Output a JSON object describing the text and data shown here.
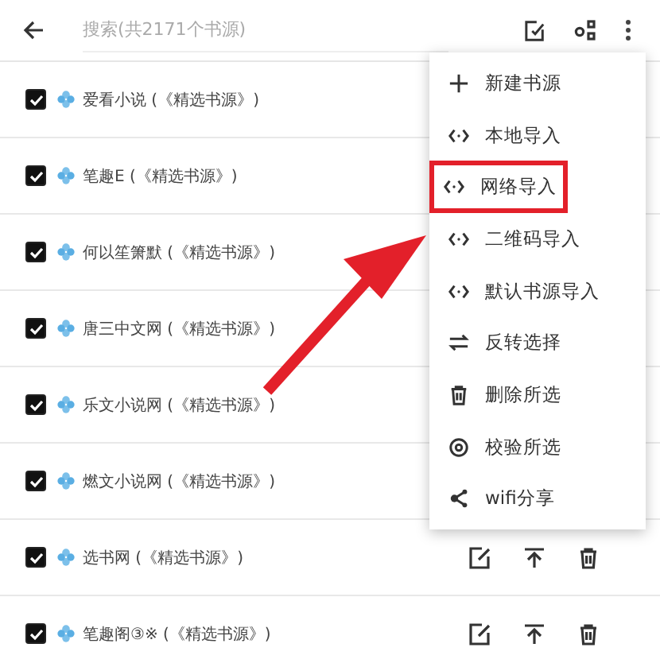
{
  "toolbar": {
    "search_placeholder": "搜索(共2171个书源)"
  },
  "rows": [
    {
      "name": "爱看小说 (《精选书源》)",
      "checked": true,
      "actions": false
    },
    {
      "name": "笔趣E (《精选书源》)",
      "checked": true,
      "actions": false
    },
    {
      "name": "何以笙箫默 (《精选书源》)",
      "checked": true,
      "actions": false
    },
    {
      "name": "唐三中文网 (《精选书源》)",
      "checked": true,
      "actions": false
    },
    {
      "name": "乐文小说网 (《精选书源》)",
      "checked": true,
      "actions": false
    },
    {
      "name": "燃文小说网 (《精选书源》)",
      "checked": true,
      "actions": false
    },
    {
      "name": "选书网 (《精选书源》)",
      "checked": true,
      "actions": true
    },
    {
      "name": "笔趣阁③※ (《精选书源》)",
      "checked": true,
      "actions": true
    }
  ],
  "menu": [
    {
      "kind": "plus",
      "label": "新建书源",
      "highlighted": false
    },
    {
      "kind": "code",
      "label": "本地导入",
      "highlighted": false
    },
    {
      "kind": "code",
      "label": "网络导入",
      "highlighted": true
    },
    {
      "kind": "code",
      "label": "二维码导入",
      "highlighted": false
    },
    {
      "kind": "code",
      "label": "默认书源导入",
      "highlighted": false
    },
    {
      "kind": "swap",
      "label": "反转选择",
      "highlighted": false
    },
    {
      "kind": "trash",
      "label": "删除所选",
      "highlighted": false
    },
    {
      "kind": "verify",
      "label": "校验所选",
      "highlighted": false
    },
    {
      "kind": "share",
      "label": "wifi分享",
      "highlighted": false
    }
  ]
}
